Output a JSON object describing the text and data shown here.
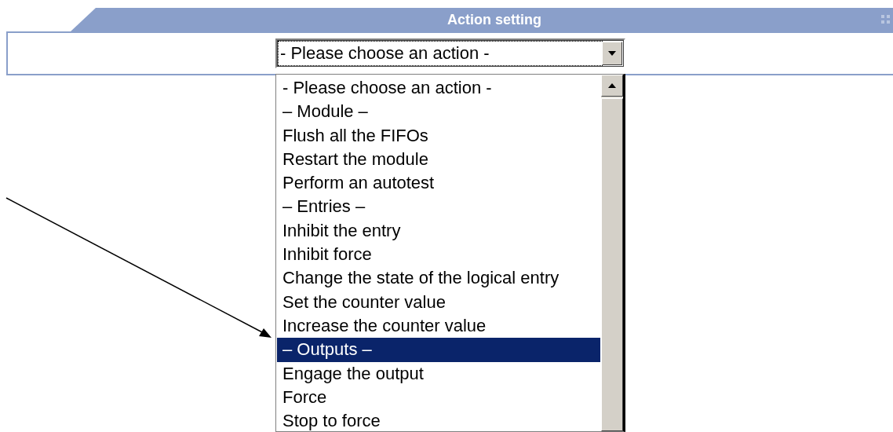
{
  "panel": {
    "title": "Action setting"
  },
  "select": {
    "value": "- Please choose an action -"
  },
  "options": [
    {
      "label": "- Please choose an action -",
      "selected": false
    },
    {
      "label": "– Module –",
      "selected": false
    },
    {
      "label": "Flush all the FIFOs",
      "selected": false
    },
    {
      "label": "Restart the module",
      "selected": false
    },
    {
      "label": "Perform an autotest",
      "selected": false
    },
    {
      "label": "– Entries –",
      "selected": false
    },
    {
      "label": "Inhibit the entry",
      "selected": false
    },
    {
      "label": "Inhibit force",
      "selected": false
    },
    {
      "label": "Change the state of the logical entry",
      "selected": false
    },
    {
      "label": "Set the counter value",
      "selected": false
    },
    {
      "label": "Increase the counter value",
      "selected": false
    },
    {
      "label": "– Outputs –",
      "selected": true
    },
    {
      "label": "Engage the output",
      "selected": false
    },
    {
      "label": "Force",
      "selected": false
    },
    {
      "label": "Stop to force",
      "selected": false
    }
  ]
}
